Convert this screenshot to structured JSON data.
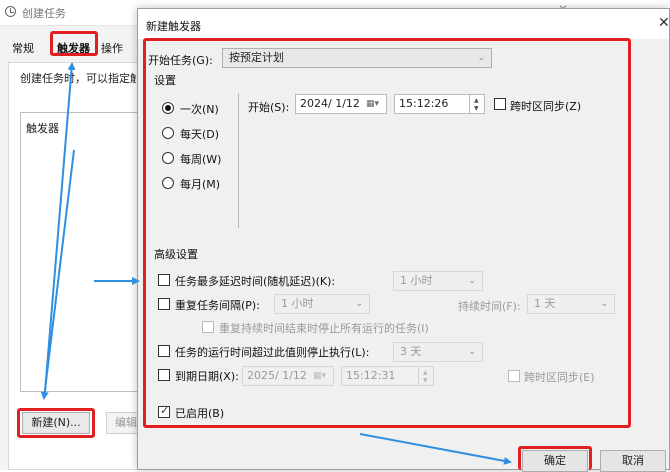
{
  "bg_window": {
    "title": "创建任务",
    "tabs": [
      "常规",
      "触发器",
      "操作"
    ],
    "description": "创建任务时，可以指定触",
    "list_label": "触发器",
    "new_button": "新建(N)...",
    "edit_button": "编辑",
    "close_glyph": "✕"
  },
  "dialog": {
    "title": "新建触发器",
    "close_glyph": "✕",
    "begin_task_label": "开始任务(G):",
    "begin_task_value": "按预定计划",
    "settings_label": "设置",
    "radios": [
      {
        "label": "一次(N)",
        "selected": true
      },
      {
        "label": "每天(D)",
        "selected": false
      },
      {
        "label": "每周(W)",
        "selected": false
      },
      {
        "label": "每月(M)",
        "selected": false
      }
    ],
    "start_label": "开始(S):",
    "start_date": "2024/ 1/12",
    "start_time": "15:12:26",
    "sync_tz_label": "跨时区同步(Z)",
    "advanced_label": "高级设置",
    "delay_label": "任务最多延迟时间(随机延迟)(K):",
    "delay_value": "1 小时",
    "repeat_label": "重复任务间隔(P):",
    "repeat_value": "1 小时",
    "duration_label": "持续时间(F):",
    "duration_value": "1 天",
    "stop_all_label": "重复持续时间结束时停止所有运行的任务(I)",
    "stop_longer_label": "任务的运行时间超过此值则停止执行(L):",
    "stop_longer_value": "3 天",
    "expire_label": "到期日期(X):",
    "expire_date": "2025/ 1/12",
    "expire_time": "15:12:31",
    "expire_sync_label": "跨时区同步(E)",
    "enabled_label": "已启用(B)",
    "ok_button": "确定",
    "cancel_button": "取消"
  },
  "colors": {
    "highlight": "#e02020",
    "arrow": "#2f8fe0"
  }
}
